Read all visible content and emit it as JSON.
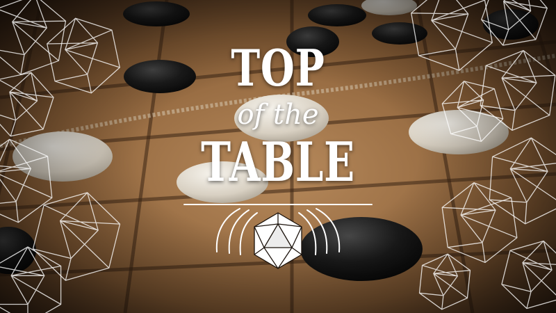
{
  "title": {
    "line1": "TOP",
    "line2": "of the",
    "line3": "TABLE"
  },
  "colors": {
    "title": "#ffffff",
    "wood_light": "#b78a5c",
    "wood_dark": "#3a2414",
    "stone_black": "#141414",
    "stone_white": "#e8e2d6",
    "dice_outline": "#ffffff"
  },
  "icons": {
    "emblem": "d20-icon",
    "decoration": "d20-outline-icon"
  }
}
